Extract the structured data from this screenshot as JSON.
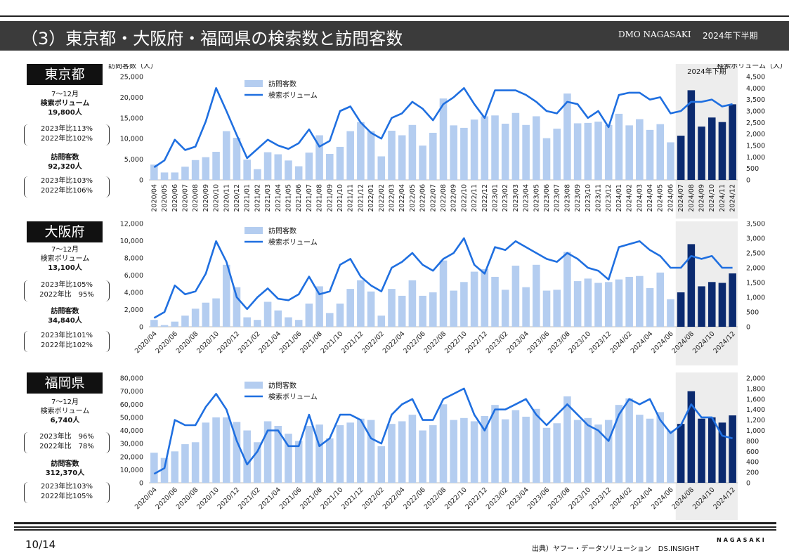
{
  "header": {
    "title": "（3）東京都・大阪府・福岡県の検索数と訪問客数",
    "org": "DMO NAGASAKI",
    "period": "2024年下半期"
  },
  "footer": {
    "page": "10/14",
    "source": "出典）ヤフー・データソリューション　DS.INSIGHT",
    "brand": "NAGASAKI"
  },
  "highlight_label": "2024年下期",
  "colors": {
    "bar_light": "#b4cdf0",
    "bar_dark": "#0b2a6f",
    "line": "#1f6fe0",
    "highlight": "#ededed"
  },
  "regions": [
    {
      "name": "東京都",
      "summary": {
        "period": "7～12月",
        "search_label": "検索ボリューム",
        "search_value": "19,800人",
        "search_cmp": [
          "2023年比113%",
          "2022年比102%"
        ],
        "visit_label": "訪問客数",
        "visit_value": "92,320人",
        "visit_cmp": [
          "2023年比103%",
          "2022年比106%"
        ]
      }
    },
    {
      "name": "大阪府",
      "summary": {
        "period": "7～12月",
        "search_label": "検索ボリューム",
        "search_value": "13,100人",
        "search_cmp": [
          "2023年比105%",
          "2022年比　95%"
        ],
        "visit_label": "訪問客数",
        "visit_value": "34,840人",
        "visit_cmp": [
          "2023年比101%",
          "2022年比102%"
        ]
      }
    },
    {
      "name": "福岡県",
      "summary": {
        "period": "7～12月",
        "search_label": "検索ボリューム",
        "search_value": "6,740人",
        "search_cmp": [
          "2023年比　96%",
          "2022年比　78%"
        ],
        "visit_label": "訪問客数",
        "visit_value": "312,370人",
        "visit_cmp": [
          "2023年比103%",
          "2022年比105%"
        ]
      }
    }
  ],
  "chart_data": [
    {
      "type": "bar",
      "region": "東京都",
      "ylabel": "訪問客数（人）",
      "y2label": "検索ボリューム（人）",
      "ylim": [
        0,
        25000
      ],
      "y2lim": [
        0,
        4500
      ],
      "yticks": [
        "0",
        "5,000",
        "10,000",
        "15,000",
        "20,000",
        "25,000"
      ],
      "y2ticks": [
        "0",
        "500",
        "1,000",
        "1,500",
        "2,000",
        "2,500",
        "3,000",
        "3,500",
        "4,000",
        "4,500"
      ],
      "legend": [
        "訪問客数",
        "検索ボリューム"
      ],
      "label_step": 1,
      "categories": [
        "2020/04",
        "2020/05",
        "2020/06",
        "2020/07",
        "2020/08",
        "2020/09",
        "2020/10",
        "2020/11",
        "2020/12",
        "2021/01",
        "2021/02",
        "2021/03",
        "2021/04",
        "2021/05",
        "2021/06",
        "2021/07",
        "2021/08",
        "2021/09",
        "2021/10",
        "2021/11",
        "2021/12",
        "2022/01",
        "2022/02",
        "2022/03",
        "2022/04",
        "2022/05",
        "2022/06",
        "2022/07",
        "2022/08",
        "2022/09",
        "2022/10",
        "2022/11",
        "2022/12",
        "2023/01",
        "2023/02",
        "2023/03",
        "2023/04",
        "2023/05",
        "2023/06",
        "2023/07",
        "2023/08",
        "2023/09",
        "2023/10",
        "2023/11",
        "2023/12",
        "2024/01",
        "2024/02",
        "2024/03",
        "2024/04",
        "2024/05",
        "2024/06",
        "2024/07",
        "2024/08",
        "2024/09",
        "2024/10",
        "2024/11",
        "2024/12"
      ],
      "series": [
        {
          "name": "訪問客数",
          "values": [
            3700,
            1800,
            1800,
            3200,
            4800,
            5500,
            6800,
            11800,
            10200,
            4900,
            2600,
            6700,
            6200,
            4700,
            3300,
            6600,
            10800,
            6300,
            8000,
            11800,
            14000,
            11800,
            5700,
            11900,
            10800,
            13300,
            8300,
            11400,
            19700,
            13200,
            12600,
            14600,
            15400,
            15600,
            13600,
            16200,
            13300,
            15400,
            10100,
            12400,
            20900,
            13700,
            13800,
            14100,
            13300,
            16000,
            13200,
            14700,
            12100,
            13500,
            9100,
            10700,
            21700,
            12900,
            15100,
            14000,
            18300
          ]
        },
        {
          "name": "検索ボリューム",
          "values": [
            550,
            850,
            1750,
            1300,
            1450,
            2550,
            4000,
            3000,
            1950,
            950,
            1350,
            1750,
            1500,
            1350,
            1600,
            2200,
            1450,
            1700,
            3000,
            3200,
            2500,
            2050,
            1800,
            2700,
            2900,
            3400,
            3100,
            2600,
            3300,
            3600,
            4000,
            3300,
            2700,
            3900,
            3900,
            3900,
            3700,
            3400,
            3000,
            2900,
            3400,
            3300,
            2700,
            3000,
            2300,
            3700,
            3800,
            3800,
            3500,
            3600,
            2900,
            3000,
            3400,
            3400,
            3500,
            3200,
            3300
          ]
        }
      ]
    },
    {
      "type": "bar",
      "region": "大阪府",
      "ylim": [
        0,
        12000
      ],
      "y2lim": [
        0,
        3500
      ],
      "yticks": [
        "0",
        "2,000",
        "4,000",
        "6,000",
        "8,000",
        "10,000",
        "12,000"
      ],
      "y2ticks": [
        "0",
        "500",
        "1,000",
        "1,500",
        "2,000",
        "2,500",
        "3,000",
        "3,500"
      ],
      "legend": [
        "訪問客数",
        "検索ボリューム"
      ],
      "label_step": 2,
      "categories": [
        "2020/04",
        "2020/05",
        "2020/06",
        "2020/07",
        "2020/08",
        "2020/09",
        "2020/10",
        "2020/11",
        "2020/12",
        "2021/01",
        "2021/02",
        "2021/03",
        "2021/04",
        "2021/05",
        "2021/06",
        "2021/07",
        "2021/08",
        "2021/09",
        "2021/10",
        "2021/11",
        "2021/12",
        "2022/01",
        "2022/02",
        "2022/03",
        "2022/04",
        "2022/05",
        "2022/06",
        "2022/07",
        "2022/08",
        "2022/09",
        "2022/10",
        "2022/11",
        "2022/12",
        "2023/01",
        "2023/02",
        "2023/03",
        "2023/04",
        "2023/05",
        "2023/06",
        "2023/07",
        "2023/08",
        "2023/09",
        "2023/10",
        "2023/11",
        "2023/12",
        "2024/01",
        "2024/02",
        "2024/03",
        "2024/04",
        "2024/05",
        "2024/06",
        "2024/07",
        "2024/08",
        "2024/09",
        "2024/10",
        "2024/11",
        "2024/12"
      ],
      "series": [
        {
          "name": "訪問客数",
          "values": [
            800,
            200,
            600,
            1300,
            2100,
            2800,
            3300,
            7200,
            4600,
            1100,
            800,
            2900,
            1900,
            1100,
            800,
            2700,
            4700,
            1600,
            2700,
            4400,
            5400,
            4100,
            1300,
            4400,
            3600,
            5400,
            3600,
            4000,
            7700,
            4200,
            5200,
            6400,
            6700,
            5800,
            4300,
            7100,
            4600,
            7200,
            4200,
            4300,
            8700,
            5300,
            5600,
            5100,
            5200,
            5500,
            5800,
            5900,
            4500,
            6300,
            3200,
            4000,
            9600,
            4700,
            5200,
            5100,
            6200
          ]
        },
        {
          "name": "検索ボリューム",
          "values": [
            300,
            500,
            1400,
            1100,
            1200,
            1800,
            2900,
            2200,
            1000,
            600,
            1000,
            1300,
            950,
            900,
            1100,
            1700,
            1100,
            1200,
            2100,
            2300,
            1700,
            1400,
            1200,
            2000,
            2200,
            2500,
            2100,
            1900,
            2300,
            2500,
            3000,
            2100,
            1800,
            2700,
            2600,
            2900,
            2700,
            2500,
            2300,
            2200,
            2500,
            2300,
            2000,
            1900,
            1600,
            2700,
            2800,
            2900,
            2600,
            2400,
            2000,
            2000,
            2400,
            2300,
            2400,
            2000,
            2000
          ]
        }
      ]
    },
    {
      "type": "bar",
      "region": "福岡県",
      "ylim": [
        0,
        80000
      ],
      "y2lim": [
        0,
        2000
      ],
      "yticks": [
        "0",
        "10,000",
        "20,000",
        "30,000",
        "40,000",
        "50,000",
        "60,000",
        "70,000",
        "80,000"
      ],
      "y2ticks": [
        "0",
        "200",
        "400",
        "600",
        "800",
        "1,000",
        "1,200",
        "1,400",
        "1,600",
        "1,800",
        "2,000"
      ],
      "legend": [
        "訪問客数",
        "検索ボリューム"
      ],
      "label_step": 2,
      "categories": [
        "2020/04",
        "2020/05",
        "2020/06",
        "2020/07",
        "2020/08",
        "2020/09",
        "2020/10",
        "2020/11",
        "2020/12",
        "2021/01",
        "2021/02",
        "2021/03",
        "2021/04",
        "2021/05",
        "2021/06",
        "2021/07",
        "2021/08",
        "2021/09",
        "2021/10",
        "2021/11",
        "2021/12",
        "2022/01",
        "2022/02",
        "2022/03",
        "2022/04",
        "2022/05",
        "2022/06",
        "2022/07",
        "2022/08",
        "2022/09",
        "2022/10",
        "2022/11",
        "2022/12",
        "2023/01",
        "2023/02",
        "2023/03",
        "2023/04",
        "2023/05",
        "2023/06",
        "2023/07",
        "2023/08",
        "2023/09",
        "2023/10",
        "2023/11",
        "2023/12",
        "2024/01",
        "2024/02",
        "2024/03",
        "2024/04",
        "2024/05",
        "2024/06",
        "2024/07",
        "2024/08",
        "2024/09",
        "2024/10",
        "2024/11",
        "2024/12"
      ],
      "series": [
        {
          "name": "訪問客数",
          "values": [
            23000,
            19000,
            24000,
            29500,
            31000,
            46000,
            50000,
            50000,
            46500,
            40000,
            31000,
            47000,
            43500,
            37500,
            32000,
            43500,
            44500,
            34000,
            44000,
            46000,
            49000,
            48000,
            28000,
            45000,
            47000,
            52000,
            40000,
            44000,
            60000,
            48000,
            49500,
            47000,
            51000,
            59500,
            48500,
            55500,
            50500,
            56500,
            42000,
            45500,
            66000,
            48000,
            49500,
            44500,
            48000,
            59500,
            64500,
            52000,
            49000,
            54000,
            40000,
            45000,
            70000,
            49000,
            50000,
            46000,
            51500
          ]
        },
        {
          "name": "検索ボリューム",
          "values": [
            170,
            280,
            1200,
            1100,
            1100,
            1450,
            1700,
            1400,
            800,
            350,
            600,
            1000,
            1000,
            700,
            700,
            1300,
            700,
            850,
            1300,
            1300,
            1200,
            850,
            750,
            1300,
            1500,
            1600,
            1200,
            1200,
            1600,
            1700,
            1800,
            1300,
            1000,
            1400,
            1400,
            1500,
            1600,
            1300,
            1100,
            1300,
            1500,
            1300,
            1100,
            1000,
            800,
            1300,
            1600,
            1500,
            1600,
            1200,
            950,
            1100,
            1500,
            1250,
            1250,
            900,
            850
          ]
        }
      ]
    }
  ]
}
